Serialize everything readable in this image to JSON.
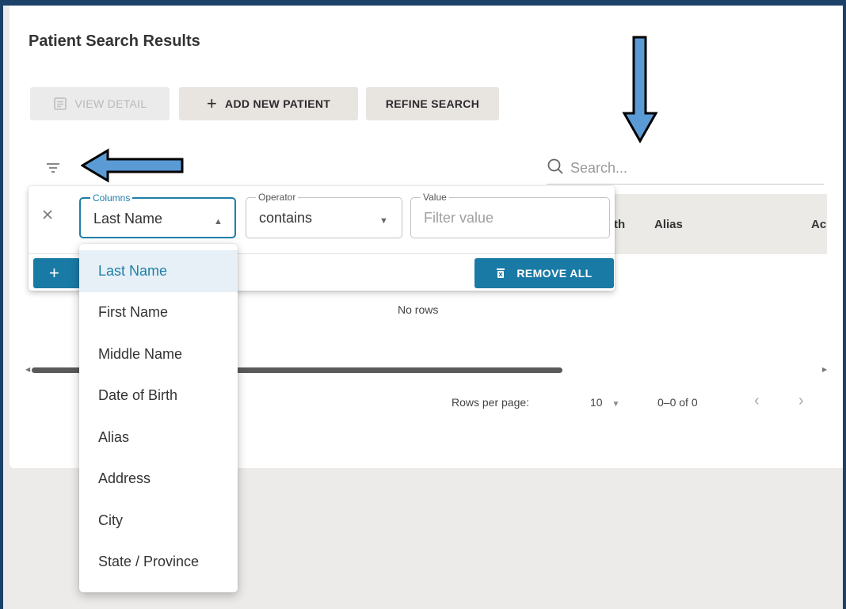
{
  "page": {
    "title": "Patient Search Results"
  },
  "toolbar": {
    "view_detail": "VIEW DETAIL",
    "add_new_patient": "ADD NEW PATIENT",
    "refine_search": "REFINE SEARCH"
  },
  "search": {
    "placeholder": "Search..."
  },
  "grid": {
    "columns_visible": [
      "th",
      "Alias",
      "Ac"
    ],
    "empty_message": "No rows"
  },
  "filter_panel": {
    "columns_label": "Columns",
    "columns_value": "Last Name",
    "operator_label": "Operator",
    "operator_value": "contains",
    "value_label": "Value",
    "value_placeholder": "Filter value",
    "add_plus": "+",
    "remove_all": "REMOVE ALL"
  },
  "column_options": [
    "Last Name",
    "First Name",
    "Middle Name",
    "Date of Birth",
    "Alias",
    "Address",
    "City",
    "State / Province"
  ],
  "pagination": {
    "rows_per_page_label": "Rows per page:",
    "rows_per_page_value": "10",
    "range": "0–0 of 0"
  },
  "colors": {
    "accent": "#1a7aa6",
    "annotation_arrow": "#5b9bd5",
    "border_frame": "#1d4269"
  }
}
